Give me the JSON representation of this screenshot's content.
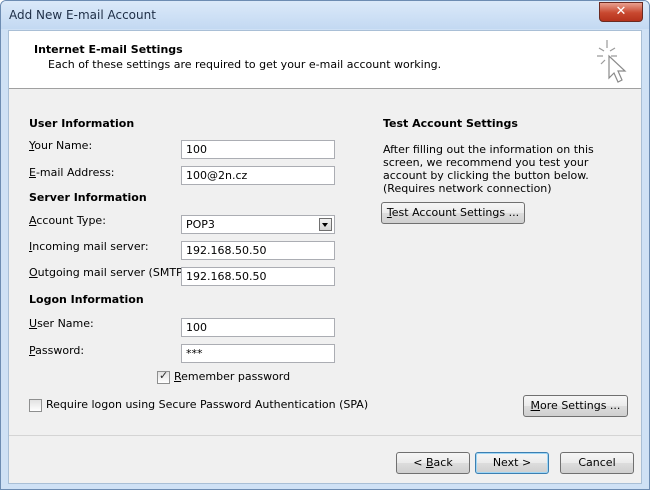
{
  "window": {
    "title": "Add New E-mail Account",
    "close_glyph": "✕"
  },
  "header": {
    "title": "Internet E-mail Settings",
    "subtitle": "Each of these settings are required to get your e-mail account working.",
    "icon": "cursor-sparkle-icon"
  },
  "user_info": {
    "section_title": "User Information",
    "name_label": "Your Name:",
    "name_value": "100",
    "email_label": "E-mail Address:",
    "email_value": "100@2n.cz"
  },
  "server_info": {
    "section_title": "Server Information",
    "account_type_label": "Account Type:",
    "account_type_value": "POP3",
    "incoming_label": "Incoming mail server:",
    "incoming_value": "192.168.50.50",
    "outgoing_label": "Outgoing mail server (SMTP):",
    "outgoing_value": "192.168.50.50"
  },
  "logon_info": {
    "section_title": "Logon Information",
    "username_label": "User Name:",
    "username_value": "100",
    "password_label": "Password:",
    "password_value": "***",
    "remember_label": "Remember password",
    "remember_checked": true,
    "spa_label": "Require logon using Secure Password Authentication (SPA)",
    "spa_checked": false
  },
  "test_settings": {
    "section_title": "Test Account Settings",
    "description": "After filling out the information on this screen, we recommend you test your account by clicking the button below. (Requires network connection)",
    "test_button": "Test Account Settings ..."
  },
  "buttons": {
    "more_settings": "More Settings ...",
    "back": "< Back",
    "next": "Next >",
    "cancel": "Cancel"
  }
}
